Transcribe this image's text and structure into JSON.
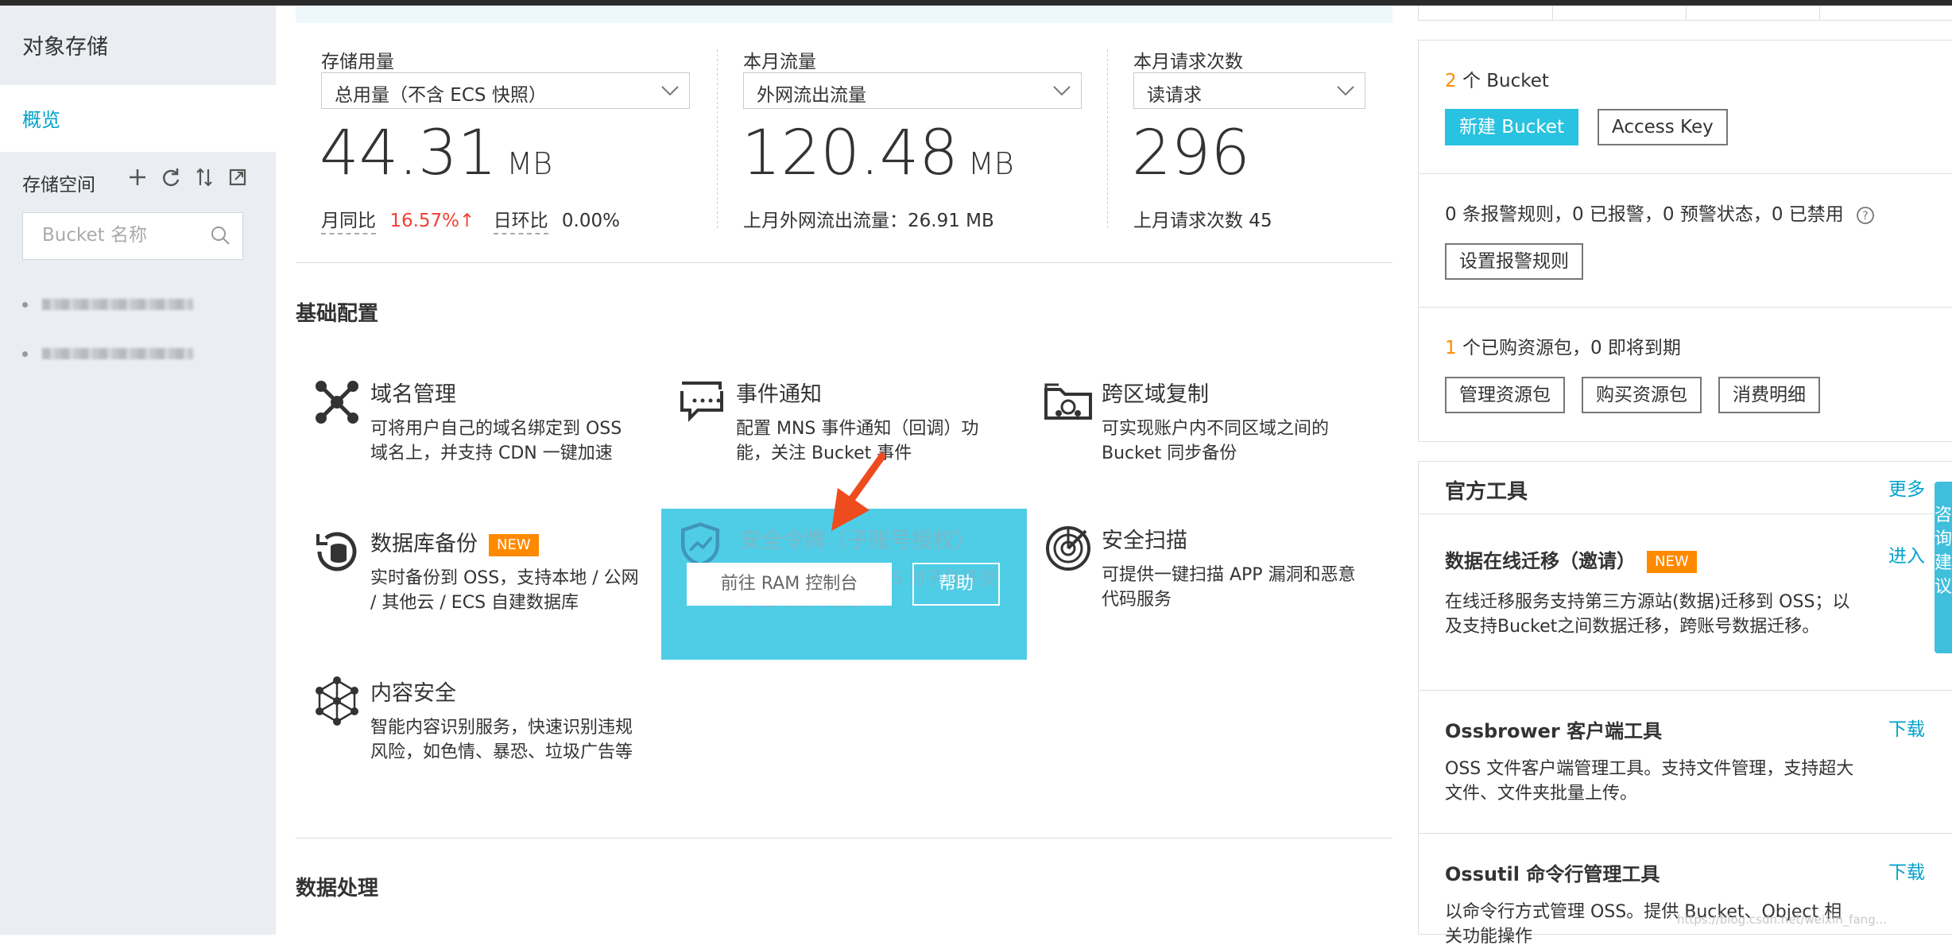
{
  "sidebar": {
    "title": "对象存储",
    "active_item": "概览",
    "storage_space_label": "存储空间",
    "icons": [
      "plus-icon",
      "refresh-icon",
      "sort-icon",
      "expand-icon"
    ],
    "search_placeholder": "Bucket 名称"
  },
  "stats": {
    "storage": {
      "label": "存储用量",
      "dropdown": "总用量（不含 ECS 快照）",
      "value": "44.31",
      "unit": "MB",
      "mom_label": "月同比",
      "mom_value": "16.57%",
      "dod_label": "日环比",
      "dod_value": "0.00%"
    },
    "traffic": {
      "label": "本月流量",
      "dropdown": "外网流出流量",
      "value": "120.48",
      "unit": "MB",
      "foot": "上月外网流出流量：26.91 MB"
    },
    "requests": {
      "label": "本月请求次数",
      "dropdown": "读请求",
      "value": "296",
      "foot": "上月请求次数  45"
    }
  },
  "basic_config": {
    "title": "基础配置",
    "items": [
      {
        "title": "域名管理",
        "desc": "可将用户自己的域名绑定到 OSS 域名上，并支持 CDN 一键加速"
      },
      {
        "title": "事件通知",
        "desc": "配置 MNS 事件通知（回调）功能，关注 Bucket 事件"
      },
      {
        "title": "跨区域复制",
        "desc": "可实现账户内不同区域之间的 Bucket 同步备份"
      },
      {
        "title": "数据库备份",
        "badge": "NEW",
        "desc": "实时备份到 OSS，支持本地 / 公网 / 其他云 / ECS 自建数据库"
      },
      {
        "title": "安全令牌（子账号授权）",
        "desc": "S 对子账号授",
        "desc2": "子临时访问权限"
      },
      {
        "title": "安全扫描",
        "desc": "可提供一键扫描 APP 漏洞和恶意代码服务"
      },
      {
        "title": "内容安全",
        "desc": "智能内容识别服务，快速识别违规风险，如色情、暴恐、垃圾广告等"
      }
    ],
    "overlay": {
      "ram_button": "前往 RAM 控制台",
      "help_button": "帮助"
    }
  },
  "data_processing": {
    "title": "数据处理"
  },
  "right_panel": {
    "bucket_count": "2",
    "bucket_suffix": "个 Bucket",
    "new_bucket": "新建 Bucket",
    "access_key": "Access Key",
    "alarm_text": "0 条报警规则，0 已报警，0 预警状态，0 已禁用",
    "alarm_button": "设置报警规则",
    "package_count": "1",
    "package_text": "个已购资源包，0 即将到期",
    "package_buttons": [
      "管理资源包",
      "购买资源包",
      "消费明细"
    ],
    "tools_title": "官方工具",
    "tools_more": "更多",
    "tools": [
      {
        "title": "数据在线迁移（邀请）",
        "badge": "NEW",
        "link": "进入",
        "desc": "在线迁移服务支持第三方源站(数据)迁移到 OSS；以及支持Bucket之间数据迁移，跨账号数据迁移。"
      },
      {
        "title": "Ossbrower 客户端工具",
        "link": "下载",
        "desc": "OSS 文件客户端管理工具。支持文件管理，支持超大文件、文件夹批量上传。"
      },
      {
        "title": "Ossutil 命令行管理工具",
        "link": "下载",
        "desc": "以命令行方式管理 OSS。提供 Bucket、Object 相关功能操作"
      }
    ],
    "float_tab": "咨询 建议"
  },
  "watermark": "https://blog.csdn.net/weixin_fang..."
}
